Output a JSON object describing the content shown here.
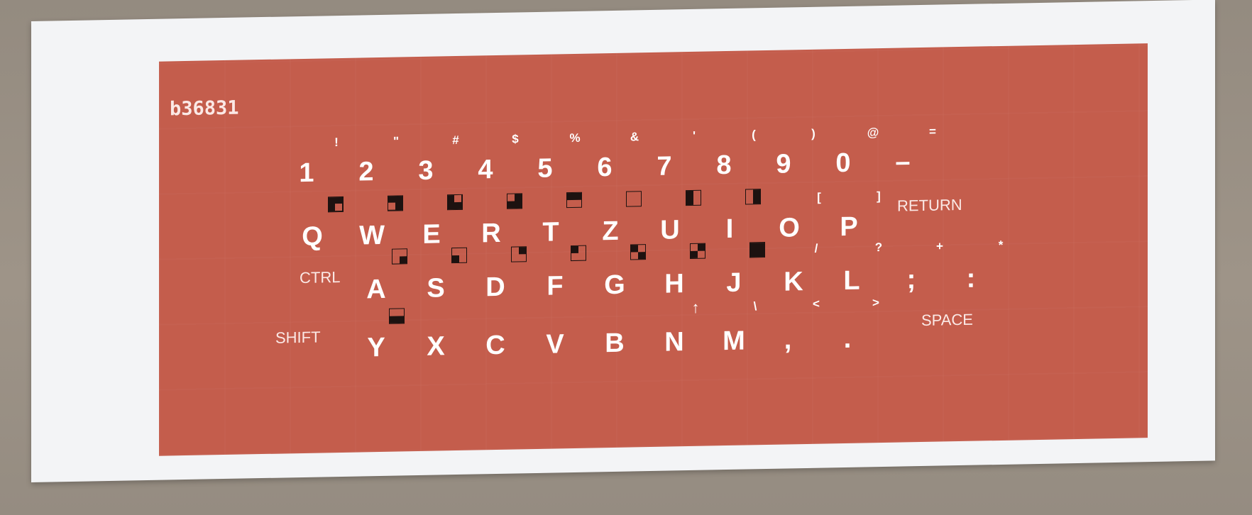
{
  "keyboard_overlay": {
    "serial": "b36831",
    "colors": {
      "overlay": "#c45d4c",
      "card": "#f3f4f6",
      "glyphs": "#ffffff",
      "block_graphics": "#1d1210"
    },
    "row1": [
      {
        "key": "1",
        "shifted": "!"
      },
      {
        "key": "2",
        "shifted": "\""
      },
      {
        "key": "3",
        "shifted": "#"
      },
      {
        "key": "4",
        "shifted": "$"
      },
      {
        "key": "5",
        "shifted": "%"
      },
      {
        "key": "6",
        "shifted": "&"
      },
      {
        "key": "7",
        "shifted": "'"
      },
      {
        "key": "8",
        "shifted": "("
      },
      {
        "key": "9",
        "shifted": ")"
      },
      {
        "key": "0",
        "shifted": "@"
      },
      {
        "key": "–",
        "shifted": "="
      }
    ],
    "row2": [
      {
        "key": "Q",
        "graphic": "q"
      },
      {
        "key": "W",
        "graphic": "w"
      },
      {
        "key": "E",
        "graphic": "e"
      },
      {
        "key": "R",
        "graphic": "r"
      },
      {
        "key": "T",
        "graphic": "t"
      },
      {
        "key": "Z",
        "graphic": "z"
      },
      {
        "key": "U",
        "graphic": "u"
      },
      {
        "key": "I",
        "graphic": "i"
      },
      {
        "key": "O",
        "shifted": "["
      },
      {
        "key": "P",
        "shifted": "]"
      }
    ],
    "row2_special": "RETURN",
    "row3_special": "CTRL",
    "row3": [
      {
        "key": "A",
        "graphic": "a"
      },
      {
        "key": "S",
        "graphic": "s"
      },
      {
        "key": "D",
        "graphic": "d"
      },
      {
        "key": "F",
        "graphic": "f"
      },
      {
        "key": "G",
        "graphic": "g"
      },
      {
        "key": "H",
        "graphic": "h"
      },
      {
        "key": "J",
        "graphic": "j"
      },
      {
        "key": "K",
        "shifted": "/"
      },
      {
        "key": "L",
        "shifted": "?"
      },
      {
        "key": ";",
        "shifted": "+"
      },
      {
        "key": ":",
        "shifted": "*"
      }
    ],
    "row4_special_left": "SHIFT",
    "row4": [
      {
        "key": "Y",
        "graphic": "y"
      },
      {
        "key": "X"
      },
      {
        "key": "C"
      },
      {
        "key": "V"
      },
      {
        "key": "B"
      },
      {
        "key": "N",
        "shifted": "↑"
      },
      {
        "key": "M",
        "shifted": "\\"
      },
      {
        "key": ",",
        "shifted": "<"
      },
      {
        "key": ".",
        "shifted": ">"
      }
    ],
    "row4_special_right": "SPACE"
  }
}
